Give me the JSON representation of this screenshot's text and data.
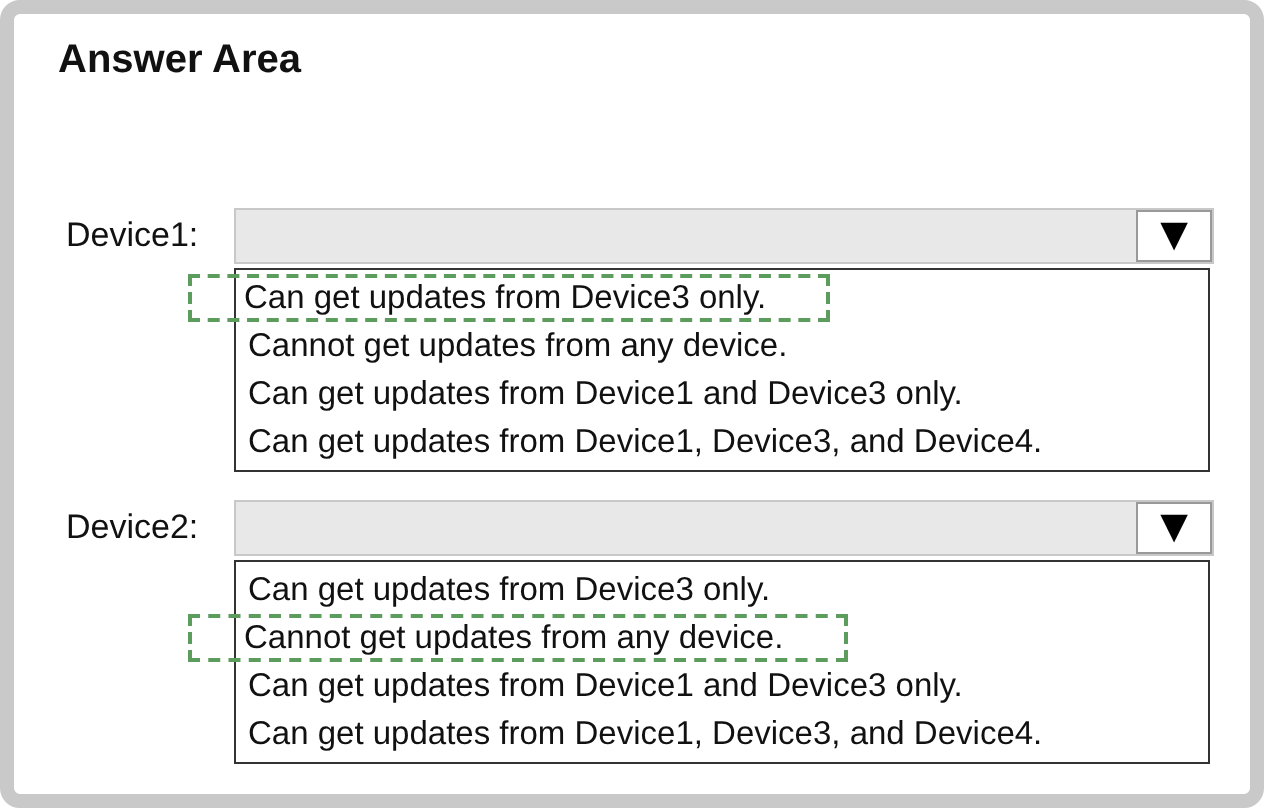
{
  "title": "Answer Area",
  "rows": [
    {
      "label": "Device1:",
      "arrow": "▼",
      "options": [
        {
          "text": "Can get updates from Device3 only.",
          "selected": true
        },
        {
          "text": "Cannot get updates from any device.",
          "selected": false
        },
        {
          "text": "Can get updates from Device1 and Device3 only.",
          "selected": false
        },
        {
          "text": "Can get updates from Device1, Device3, and Device4.",
          "selected": false
        }
      ]
    },
    {
      "label": "Device2:",
      "arrow": "▼",
      "options": [
        {
          "text": "Can get updates from Device3 only.",
          "selected": false
        },
        {
          "text": "Cannot get updates from any device.",
          "selected": true
        },
        {
          "text": "Can get updates from Device1 and Device3 only.",
          "selected": false
        },
        {
          "text": "Can get updates from Device1, Device3, and Device4.",
          "selected": false
        }
      ]
    }
  ]
}
